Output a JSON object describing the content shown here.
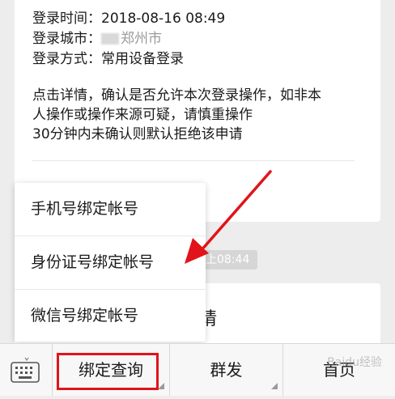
{
  "message": {
    "login_time_label": "登录时间：",
    "login_time_value": "2018-08-16 08:49",
    "login_city_label": "登录城市：",
    "login_city_value": "郑州市",
    "login_method_label": "登录方式：",
    "login_method_value": "常用设备登录",
    "notice_line1": "点击详情，确认是否允许本次登录操作，如非本",
    "notice_line2": "人操作或操作来源可疑，请慎重操作",
    "notice_line3": "30分钟内未确认则默认拒绝该申请"
  },
  "timestamp": "上08:44",
  "second_message_partial": "请",
  "popup_menu": {
    "items": [
      "手机号绑定帐号",
      "身份证号绑定帐号",
      "微信号绑定帐号"
    ]
  },
  "bottom_bar": {
    "keyboard_icon": "keyboard-icon",
    "buttons": [
      "绑定查询",
      "群发",
      "首页"
    ]
  },
  "annotation": {
    "highlight_color": "#e0141a",
    "arrow_color": "#e0141a"
  },
  "watermark": "Baidu经验"
}
